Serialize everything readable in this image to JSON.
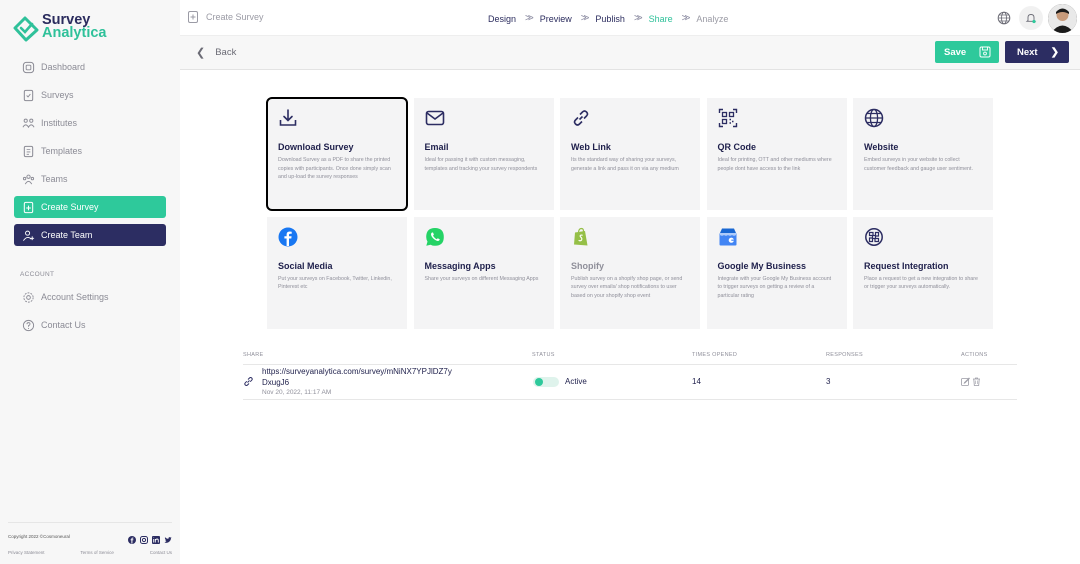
{
  "brand": {
    "line1": "Survey",
    "line2": "Analytica"
  },
  "sidebar": {
    "items": [
      {
        "label": "Dashboard",
        "icon": "dashboard-icon"
      },
      {
        "label": "Surveys",
        "icon": "surveys-icon"
      },
      {
        "label": "Institutes",
        "icon": "institutes-icon"
      },
      {
        "label": "Templates",
        "icon": "templates-icon"
      },
      {
        "label": "Teams",
        "icon": "teams-icon"
      }
    ],
    "create_survey": "Create Survey",
    "create_team": "Create Team",
    "account_label": "ACCOUNT",
    "account_settings": "Account Settings",
    "contact_us": "Contact Us",
    "copyright": "Copyright 2022 ©Cosmoneural",
    "footer_links": [
      "Privacy Statement",
      "Terms of Service",
      "Contact Us"
    ]
  },
  "header": {
    "breadcrumb": "Create Survey",
    "steps": [
      "Design",
      "Preview",
      "Publish",
      "Share",
      "Analyze"
    ],
    "active_step": "Share"
  },
  "subbar": {
    "back": "Back",
    "save": "Save",
    "next": "Next"
  },
  "cards": [
    {
      "title": "Download Survey",
      "desc": "Download Survey as a PDF to share the printed copies with participants. Once done simply scan and up-load the survey responses",
      "icon": "download-icon"
    },
    {
      "title": "Email",
      "desc": "Ideal for passing it with custom messaging, templates and tracking your survey respondents",
      "icon": "email-icon"
    },
    {
      "title": "Web Link",
      "desc": "Its the standard way of sharing your surveys, generate a link and pass it on via any medium",
      "icon": "link-icon"
    },
    {
      "title": "QR Code",
      "desc": "Ideal for printing, OTT and other mediums where people dont have access to the link",
      "icon": "qr-code-icon"
    },
    {
      "title": "Website",
      "desc": "Embed surveys in your website to collect customer feedback and gauge user sentiment.",
      "icon": "globe-icon"
    },
    {
      "title": "Social Media",
      "desc": "Put your surveys on Facebook, Twitter, Linkedin, Pinterest etc",
      "icon": "facebook-icon"
    },
    {
      "title": "Messaging Apps",
      "desc": "Share your surveys on different Messaging Apps",
      "icon": "whatsapp-icon"
    },
    {
      "title": "Shopify",
      "desc": "Publish survey on a shopify shop page, or send survey over emails/ shop notifications to user based on your shopify shop event",
      "icon": "shopify-icon"
    },
    {
      "title": "Google My Business",
      "desc": "Integrate with your Google My Business account to trigger surveys on getting a review of a particular rating",
      "icon": "google-my-business-icon"
    },
    {
      "title": "Request Integration",
      "desc": "Place a request to get a new integration to share or trigger your surveys automatically.",
      "icon": "integration-icon"
    }
  ],
  "table": {
    "headers": {
      "share": "SHARE",
      "status": "STATUS",
      "times": "TIMES OPENED",
      "responses": "RESPONSES",
      "actions": "ACTIONS"
    },
    "rows": [
      {
        "link": "https://surveyanalytica.com/survey/mNiNX7YPJlDZ7yDxugJ6",
        "date": "Nov 20, 2022, 11:17 AM",
        "status": "Active",
        "times_opened": "14",
        "responses": "3"
      }
    ]
  },
  "colors": {
    "accent": "#2ec99b",
    "primary_dark": "#2c2d62"
  }
}
